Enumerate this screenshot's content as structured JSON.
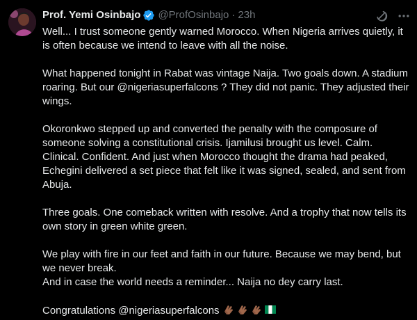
{
  "author": {
    "display_name": "Prof. Yemi Osinbajo",
    "handle": "@ProfOsinbajo",
    "separator": "·",
    "time": "23h",
    "verified": true,
    "verified_color": "#1d9bf0"
  },
  "icons": {
    "grok": "grok-icon",
    "more": "more-icon"
  },
  "tweet": {
    "paragraphs": [
      [
        "Well... I trust someone gently warned Morocco. When Nigeria arrives quietly, it is often because we intend to leave with all the noise."
      ],
      [
        "What happened tonight in Rabat was vintage Naija. Two goals down. A stadium roaring. But our @nigeriasuperfalcons ? They did not panic. They adjusted their wings."
      ],
      [
        "Okoronkwo stepped up and converted the penalty with the composure of someone solving a constitutional crisis. Ijamilusi brought us level. Calm. Clinical. Confident. And just when Morocco thought the drama had peaked, Echegini delivered a set piece that felt like it was signed, sealed, and sent from Abuja."
      ],
      [
        "Three goals. One comeback written with resolve. And a trophy that now tells its own story in green white green."
      ],
      [
        "We play with fire in our feet and faith in our future. Because we may bend, but we never break.",
        "And in case the world needs a reminder... Naija no dey carry last."
      ],
      [
        "Congratulations @nigeriasuperfalcons"
      ]
    ],
    "emojis": [
      "clapping-hands-medium-dark",
      "clapping-hands-medium-dark",
      "clapping-hands-medium-dark",
      "flag-nigeria"
    ]
  },
  "colors": {
    "background": "#000000",
    "text": "#e7e9ea",
    "muted": "#71767b",
    "nigeria_green": "#008751"
  }
}
